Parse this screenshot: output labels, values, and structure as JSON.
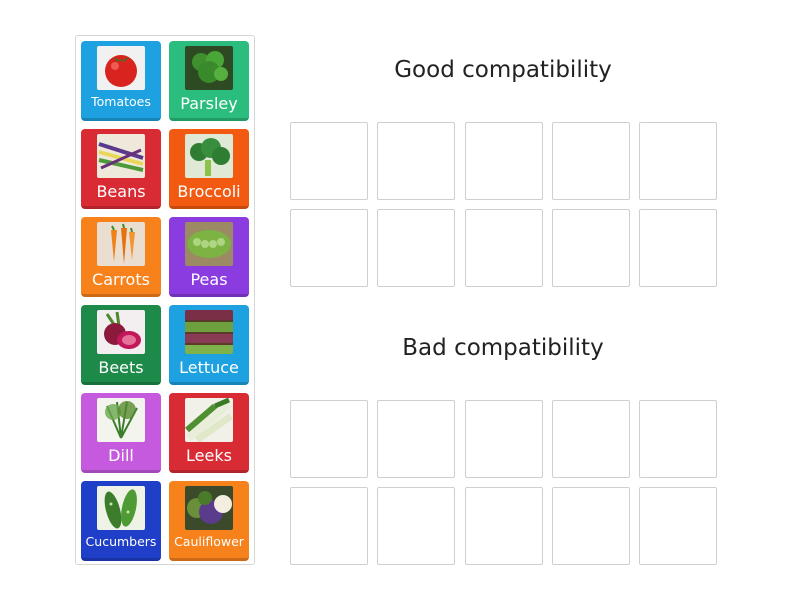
{
  "tiles": [
    {
      "label": "Tomatoes",
      "icon": "tomato-icon",
      "color": "#1da1e0"
    },
    {
      "label": "Parsley",
      "icon": "parsley-icon",
      "color": "#2bbd7e"
    },
    {
      "label": "Beans",
      "icon": "beans-icon",
      "color": "#d92b34"
    },
    {
      "label": "Broccoli",
      "icon": "broccoli-icon",
      "color": "#f25a12"
    },
    {
      "label": "Carrots",
      "icon": "carrot-icon",
      "color": "#f7821b"
    },
    {
      "label": "Peas",
      "icon": "peas-icon",
      "color": "#8a3ce0"
    },
    {
      "label": "Beets",
      "icon": "beet-icon",
      "color": "#1e8a4a"
    },
    {
      "label": "Lettuce",
      "icon": "lettuce-icon",
      "color": "#1da1e0"
    },
    {
      "label": "Dill",
      "icon": "dill-icon",
      "color": "#c55adf"
    },
    {
      "label": "Leeks",
      "icon": "leek-icon",
      "color": "#d92b34"
    },
    {
      "label": "Cucumbers",
      "icon": "cucumber-icon",
      "color": "#1f3fc9"
    },
    {
      "label": "Cauliflower",
      "icon": "cauliflower-icon",
      "color": "#f7821b"
    }
  ],
  "groups": {
    "good": {
      "title": "Good compatibility"
    },
    "bad": {
      "title": "Bad compatibility"
    }
  }
}
